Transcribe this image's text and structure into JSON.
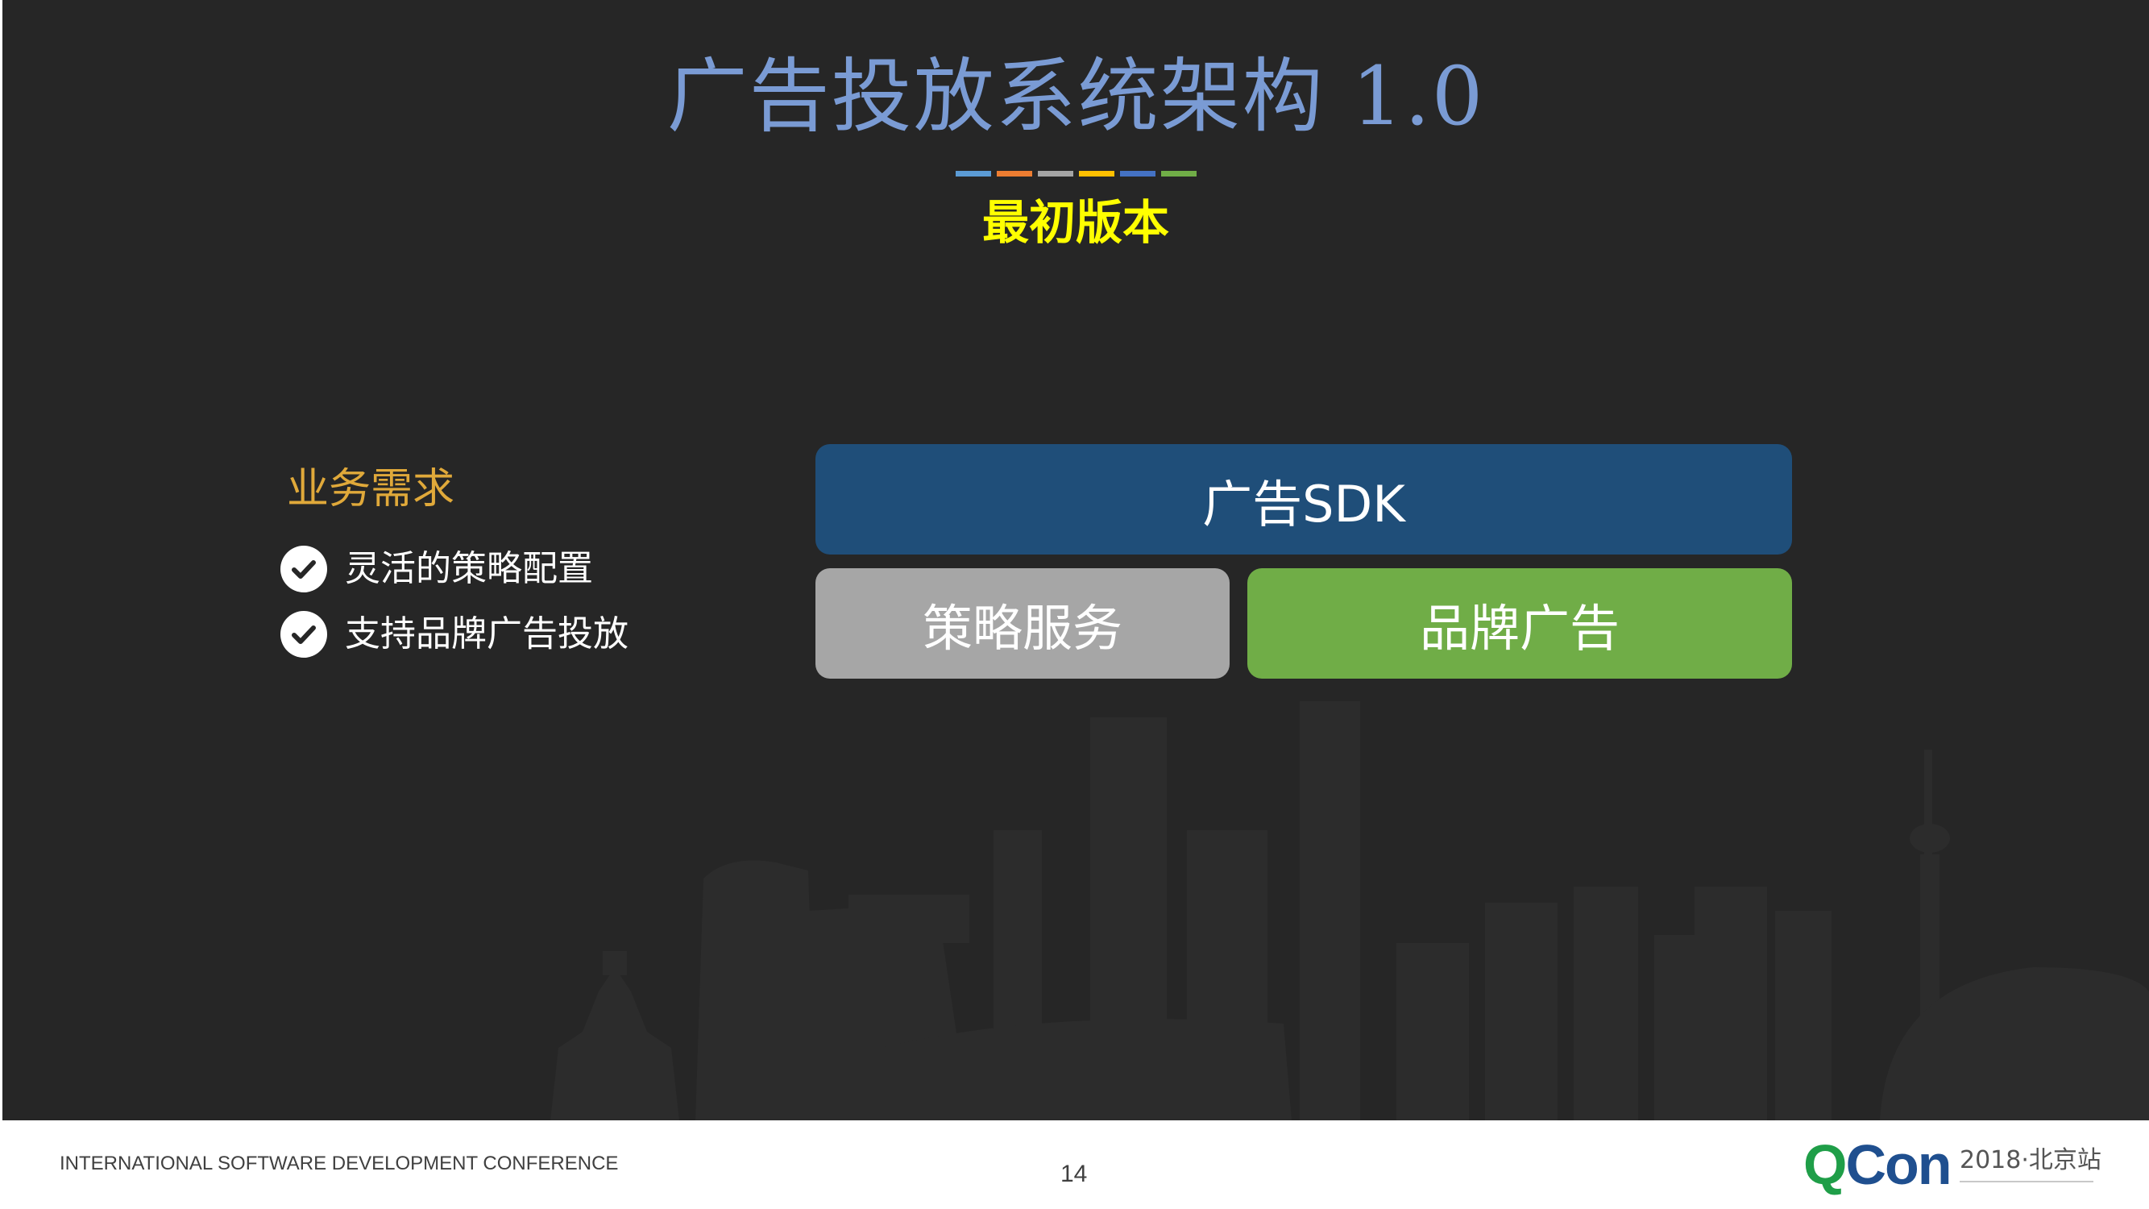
{
  "slide": {
    "title": "广告投放系统架构 1.0",
    "subtitle": "最初版本",
    "title_bar_colors": [
      "#5b9bd5",
      "#ed7d31",
      "#a5a5a5",
      "#ffc000",
      "#4472c4",
      "#70ad47"
    ]
  },
  "requirements": {
    "heading": "业务需求",
    "items": [
      {
        "label": "灵活的策略配置",
        "icon": "check-circle-icon"
      },
      {
        "label": "支持品牌广告投放",
        "icon": "check-circle-icon"
      }
    ]
  },
  "architecture": {
    "sdk_label": "广告SDK",
    "strategy_label": "策略服务",
    "brand_label": "品牌广告",
    "colors": {
      "sdk": "#1f4e79",
      "strategy": "#a6a6a6",
      "brand": "#70ad47"
    }
  },
  "footer": {
    "conference": "INTERNATIONAL SOFTWARE DEVELOPMENT CONFERENCE",
    "page_number": "14",
    "logo_q": "Q",
    "logo_con": "Con",
    "edition": "2018·北京站"
  }
}
